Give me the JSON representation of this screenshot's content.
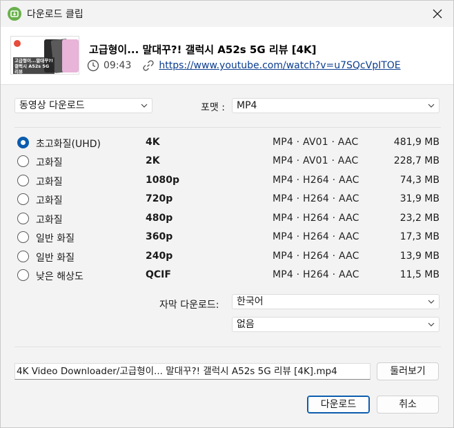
{
  "window": {
    "title": "다운로드 클립"
  },
  "video": {
    "title": "고급형이... 말대꾸?! 갤럭시 A52s 5G 리뷰 [4K]",
    "duration": "09:43",
    "url": "https://www.youtube.com/watch?v=u7SQcVpITOE",
    "thumbnail_text": "고급형이...말대꾸?! 갤럭시 A52s 5G 리뷰"
  },
  "download_type": {
    "selected": "동영상 다운로드"
  },
  "format": {
    "label": "포맷 :",
    "selected": "MP4"
  },
  "quality_options": [
    {
      "name": "초고화질(UHD)",
      "res": "4K",
      "fmt": "MP4 · AV01 · AAC",
      "size": "481,9 MB",
      "checked": true
    },
    {
      "name": "고화질",
      "res": "2K",
      "fmt": "MP4 · AV01 · AAC",
      "size": "228,7 MB",
      "checked": false
    },
    {
      "name": "고화질",
      "res": "1080p",
      "fmt": "MP4 · H264 · AAC",
      "size": "74,3 MB",
      "checked": false
    },
    {
      "name": "고화질",
      "res": "720p",
      "fmt": "MP4 · H264 · AAC",
      "size": "31,9 MB",
      "checked": false
    },
    {
      "name": "고화질",
      "res": "480p",
      "fmt": "MP4 · H264 · AAC",
      "size": "23,2 MB",
      "checked": false
    },
    {
      "name": "일반 화질",
      "res": "360p",
      "fmt": "MP4 · H264 · AAC",
      "size": "17,3 MB",
      "checked": false
    },
    {
      "name": "일반 화질",
      "res": "240p",
      "fmt": "MP4 · H264 · AAC",
      "size": "13,9 MB",
      "checked": false
    },
    {
      "name": "낮은 해상도",
      "res": "QCIF",
      "fmt": "MP4 · H264 · AAC",
      "size": "11,5 MB",
      "checked": false
    }
  ],
  "subtitles": {
    "label": "자막 다운로드:",
    "language": "한국어",
    "second": "없음"
  },
  "output_path": "4K Video Downloader/고급형이... 말대꾸?! 갤럭시 A52s 5G 리뷰 [4K].mp4",
  "buttons": {
    "browse": "둘러보기",
    "download": "다운로드",
    "cancel": "취소"
  },
  "icons": {
    "app": "download-icon",
    "close": "close-icon",
    "clock": "clock-icon",
    "link": "link-icon",
    "chevron": "chevron-down-icon"
  },
  "colors": {
    "accent": "#0b5cad",
    "app_icon": "#6ab04c",
    "link": "#0a3d8f"
  }
}
